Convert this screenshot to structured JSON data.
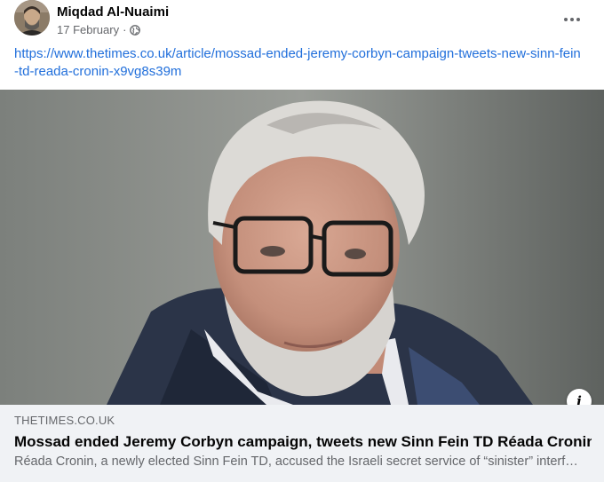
{
  "post": {
    "author": "Miqdad Al-Nuaimi",
    "date": "17 February",
    "date_separator": "·",
    "audience_icon": "globe-icon",
    "more_icon": "more-horizontal-icon",
    "link_url": "https://www.thetimes.co.uk/article/mossad-ended-jeremy-corbyn-campaign-tweets-new-sinn-fein-td-reada-cronin-x9vg8s39m"
  },
  "preview": {
    "domain": "THETIMES.CO.UK",
    "headline": "Mossad ended Jeremy Corbyn campaign, tweets new Sinn Fein TD Réada Cronin",
    "description": "Réada Cronin, a newly elected Sinn Fein TD, accused the Israeli secret service of “sinister” interference in British politics",
    "info_icon": "info-icon",
    "info_glyph": "i"
  },
  "colors": {
    "link": "#216fdb",
    "secondary_text": "#65676b",
    "preview_bg": "#f0f2f5"
  }
}
